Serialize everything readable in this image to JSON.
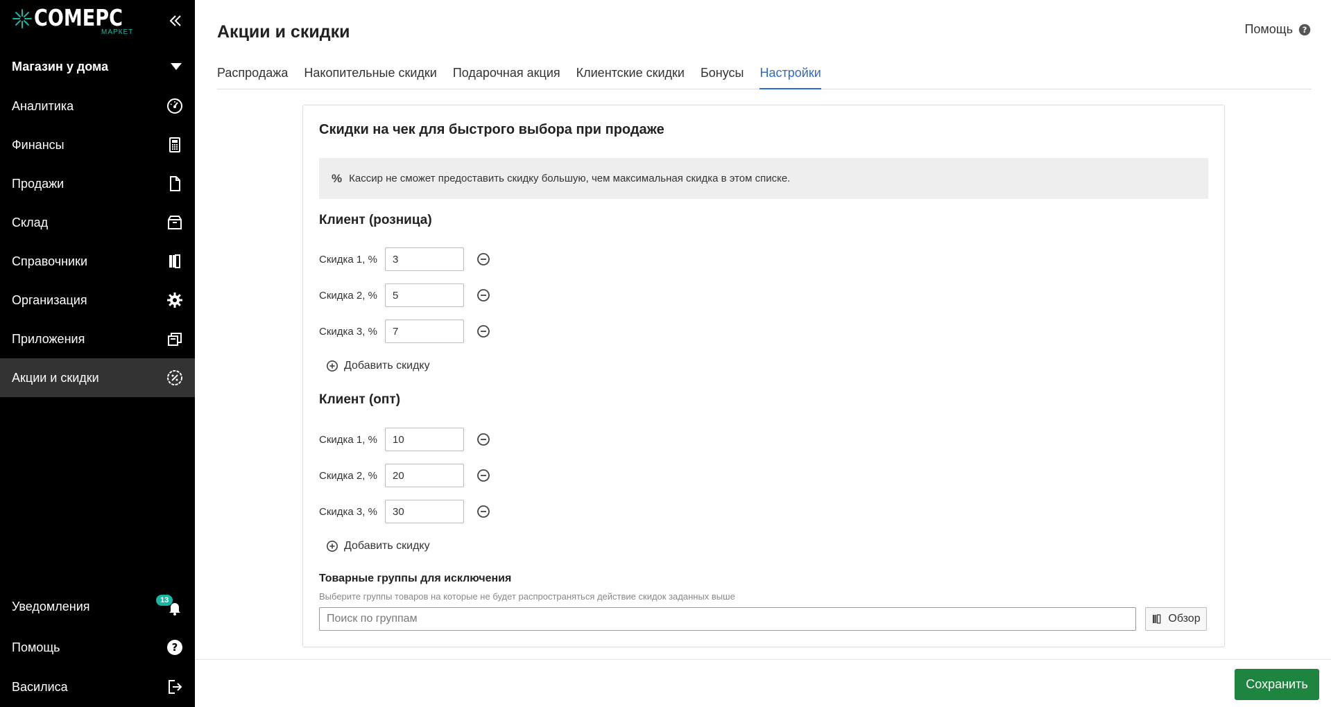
{
  "sidebar": {
    "logo_main": "COMEPC",
    "logo_sub": "МАРКЕТ",
    "store_name": "Магазин у дома",
    "items": [
      {
        "label": "Аналитика",
        "icon": "dashboard-gauge-icon"
      },
      {
        "label": "Финансы",
        "icon": "calculator-icon"
      },
      {
        "label": "Продажи",
        "icon": "document-icon"
      },
      {
        "label": "Склад",
        "icon": "box-icon"
      },
      {
        "label": "Справочники",
        "icon": "books-icon"
      },
      {
        "label": "Организация",
        "icon": "gear-icon"
      },
      {
        "label": "Приложения",
        "icon": "windows-icon"
      },
      {
        "label": "Акции и скидки",
        "icon": "percent-badge-icon",
        "active": true
      }
    ],
    "bottom": {
      "notifications_label": "Уведомления",
      "notifications_count": "13",
      "help_label": "Помощь",
      "user_name": "Василиса"
    }
  },
  "header": {
    "title": "Акции и скидки",
    "help_label": "Помощь"
  },
  "tabs": [
    {
      "label": "Распродажа"
    },
    {
      "label": "Накопительные скидки"
    },
    {
      "label": "Подарочная акция"
    },
    {
      "label": "Клиентские скидки"
    },
    {
      "label": "Бонусы"
    },
    {
      "label": "Настройки",
      "active": true
    }
  ],
  "card": {
    "title": "Скидки на чек для быстрого выбора при продаже",
    "info_icon": "%",
    "info_text": "Кассир не сможет предоставить скидку большую, чем максимальная скидка в этом списке.",
    "retail": {
      "title": "Клиент (розница)",
      "discounts": [
        {
          "label": "Скидка 1, %",
          "value": "3"
        },
        {
          "label": "Скидка 2, %",
          "value": "5"
        },
        {
          "label": "Скидка 3, %",
          "value": "7"
        }
      ],
      "add_label": "Добавить скидку"
    },
    "wholesale": {
      "title": "Клиент (опт)",
      "discounts": [
        {
          "label": "Скидка 1, %",
          "value": "10"
        },
        {
          "label": "Скидка 2, %",
          "value": "20"
        },
        {
          "label": "Скидка 3, %",
          "value": "30"
        }
      ],
      "add_label": "Добавить скидку"
    },
    "exclusions": {
      "title": "Товарные группы для исключения",
      "hint": "Выберите группы товаров на которые не будет распространяться действие скидок заданных выше",
      "search_placeholder": "Поиск по группам",
      "browse_label": "Обзор"
    }
  },
  "footer": {
    "save_label": "Сохранить"
  },
  "colors": {
    "sidebar_bg": "#000000",
    "active_nav_bg": "#333333",
    "accent_blue": "#2d6ad2",
    "save_green": "#1e8540",
    "badge_teal": "#16b7a3"
  }
}
